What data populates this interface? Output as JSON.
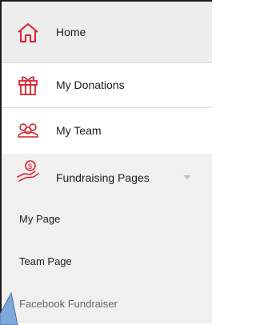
{
  "menu": {
    "home": {
      "label": "Home",
      "icon": "home-icon"
    },
    "donations": {
      "label": "My Donations",
      "icon": "gift-icon"
    },
    "team": {
      "label": "My Team",
      "icon": "team-icon"
    },
    "fundraising": {
      "label": "Fundraising Pages",
      "icon": "fundraising-hand-icon",
      "expanded": true,
      "items": [
        "My Page",
        "Team Page",
        "Facebook Fundraiser"
      ]
    }
  },
  "colors": {
    "accent": "#d6222f",
    "selected_bg": "#ededed",
    "sub_bg": "#f0f0f0"
  }
}
